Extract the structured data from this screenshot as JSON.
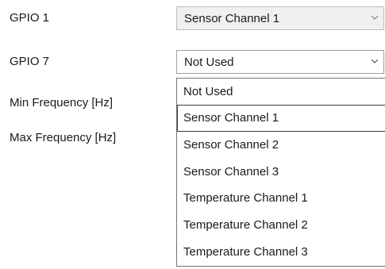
{
  "form": {
    "rows": [
      {
        "label": "GPIO 1",
        "value": "Sensor Channel 1"
      },
      {
        "label": "GPIO 7",
        "value": "Not Used"
      },
      {
        "label": "Min Frequency [Hz]"
      },
      {
        "label": "Max Frequency [Hz]"
      }
    ]
  },
  "dropdown": {
    "options": [
      "Not Used",
      "Sensor Channel 1",
      "Sensor Channel 2",
      "Sensor Channel 3",
      "Temperature Channel 1",
      "Temperature Channel 2",
      "Temperature Channel 3"
    ],
    "selected": "Not Used",
    "focused": "Sensor Channel 1"
  },
  "icons": {
    "chevron": "chevron-down-icon"
  },
  "colors": {
    "combo_bg": "#f0f0f0",
    "border": "#bdbdbd",
    "list_border": "#767676"
  }
}
